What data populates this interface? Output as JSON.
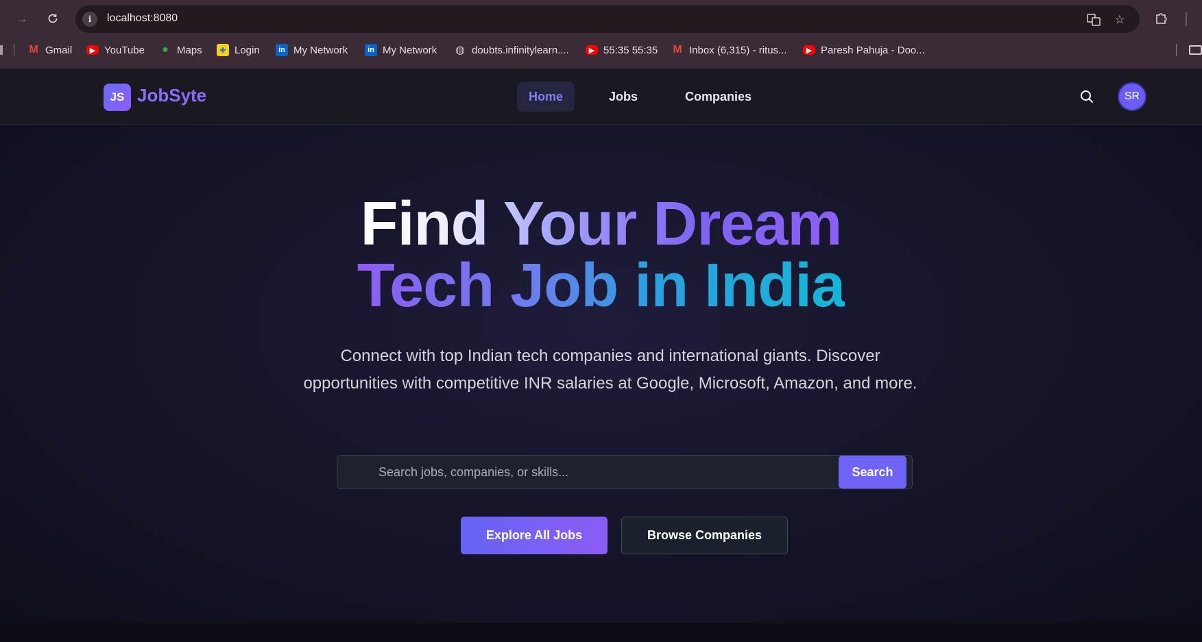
{
  "browser": {
    "url": "localhost:8080",
    "bookmarks": [
      {
        "label": "Gmail",
        "icon": "gmail-icon"
      },
      {
        "label": "YouTube",
        "icon": "youtube-icon"
      },
      {
        "label": "Maps",
        "icon": "maps-icon"
      },
      {
        "label": "Login",
        "icon": "login-icon"
      },
      {
        "label": "My Network",
        "icon": "linkedin-icon"
      },
      {
        "label": "My Network",
        "icon": "linkedin-icon"
      },
      {
        "label": "doubts.infinitylearn....",
        "icon": "globe-icon"
      },
      {
        "label": "55:35 55:35",
        "icon": "youtube-icon"
      },
      {
        "label": "Inbox (6,315) - ritus...",
        "icon": "gmail-icon"
      },
      {
        "label": "Paresh Pahuja - Doo...",
        "icon": "youtube-icon"
      }
    ]
  },
  "site": {
    "logo_initials": "JS",
    "logo_name": "JobSyte",
    "nav": [
      {
        "label": "Home",
        "active": true
      },
      {
        "label": "Jobs",
        "active": false
      },
      {
        "label": "Companies",
        "active": false
      }
    ],
    "avatar_initials": "SR",
    "accent": "#6e63f5"
  },
  "hero": {
    "headline_line1": "Find Your Dream",
    "headline_line2": "Tech Job in India",
    "subtitle": "Connect with top Indian tech companies and international giants. Discover opportunities with competitive INR salaries at Google, Microsoft, Amazon, and more.",
    "search_placeholder": "Search jobs, companies, or skills...",
    "search_button": "Search",
    "primary_cta": "Explore All Jobs",
    "secondary_cta": "Browse Companies"
  }
}
